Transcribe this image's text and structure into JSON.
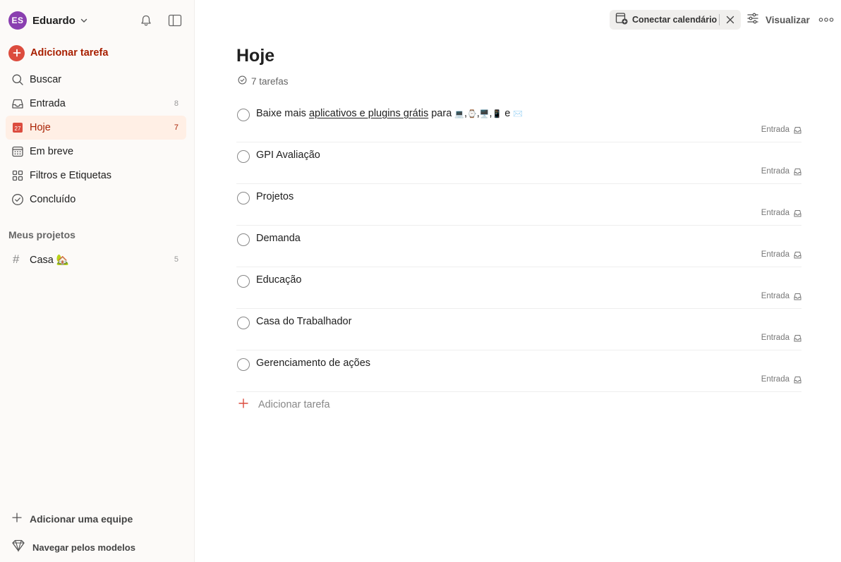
{
  "user": {
    "initials": "ES",
    "name": "Eduardo",
    "avatar_color": "#8a3fb0"
  },
  "sidebar": {
    "add_task_label": "Adicionar tarefa",
    "nav": [
      {
        "label": "Buscar",
        "icon": "search-icon",
        "count": ""
      },
      {
        "label": "Entrada",
        "icon": "inbox-icon",
        "count": "8"
      },
      {
        "label": "Hoje",
        "icon": "calendar-today-icon",
        "count": "7",
        "day": "27",
        "active": true
      },
      {
        "label": "Em breve",
        "icon": "calendar-upcoming-icon",
        "count": ""
      },
      {
        "label": "Filtros e Etiquetas",
        "icon": "filters-icon",
        "count": ""
      },
      {
        "label": "Concluído",
        "icon": "check-circle-icon",
        "count": ""
      }
    ],
    "projects_title": "Meus projetos",
    "projects": [
      {
        "label": "Casa 🏡",
        "count": "5"
      }
    ],
    "add_team_label": "Adicionar uma equipe",
    "browse_templates_label": "Navegar pelos modelos"
  },
  "topbar": {
    "connect_calendar_label": "Conectar calendário",
    "view_label": "Visualizar"
  },
  "main": {
    "title": "Hoje",
    "task_count_label": "7 tarefas",
    "first_task": {
      "prefix": "Baixe mais ",
      "link": "aplicativos e plugins grátis",
      "middle": " para ",
      "emoji1": "💻",
      "sep1": ",",
      "emoji2": "⌚",
      "sep2": ",",
      "emoji3": "🖥️",
      "sep3": ",",
      "emoji4": "📱",
      "conj": " e ",
      "emoji5": "✉️"
    },
    "tasks": [
      {
        "title": "GPI Avaliação",
        "project": "Entrada"
      },
      {
        "title": "Projetos",
        "project": "Entrada"
      },
      {
        "title": "Demanda",
        "project": "Entrada"
      },
      {
        "title": "Educação",
        "project": "Entrada"
      },
      {
        "title": "Casa do Trabalhador",
        "project": "Entrada"
      },
      {
        "title": "Gerenciamento de ações",
        "project": "Entrada"
      }
    ],
    "first_task_project": "Entrada",
    "add_task_label": "Adicionar tarefa"
  },
  "colors": {
    "accent": "#dc4c3e",
    "accent_text": "#a81f00",
    "active_bg": "#ffefe5",
    "sidebar_bg": "#fcfaf8"
  }
}
